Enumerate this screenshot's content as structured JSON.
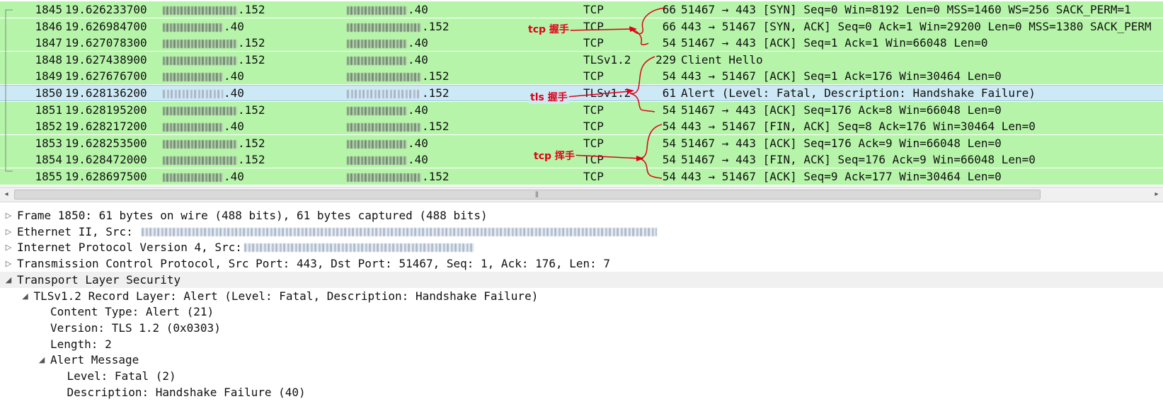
{
  "packets": [
    {
      "no": "1845",
      "time": "19.626233700",
      "src_suffix": ".152",
      "dst_suffix": ".40",
      "proto": "TCP",
      "len": "66",
      "info": "51467 → 443 [SYN] Seq=0 Win=8192 Len=0 MSS=1460 WS=256 SACK_PERM=1",
      "selected": false
    },
    {
      "no": "1846",
      "time": "19.626984700",
      "src_suffix": ".40",
      "dst_suffix": ".152",
      "proto": "TCP",
      "len": "66",
      "info": "443 → 51467 [SYN, ACK] Seq=0 Ack=1 Win=29200 Len=0 MSS=1380 SACK_PERM",
      "selected": false
    },
    {
      "no": "1847",
      "time": "19.627078300",
      "src_suffix": ".152",
      "dst_suffix": ".40",
      "proto": "TCP",
      "len": "54",
      "info": "51467 → 443 [ACK] Seq=1 Ack=1 Win=66048 Len=0",
      "selected": false
    },
    {
      "no": "1848",
      "time": "19.627438900",
      "src_suffix": ".152",
      "dst_suffix": ".40",
      "proto": "TLSv1.2",
      "len": "229",
      "info": "Client Hello",
      "selected": false
    },
    {
      "no": "1849",
      "time": "19.627676700",
      "src_suffix": ".40",
      "dst_suffix": ".152",
      "proto": "TCP",
      "len": "54",
      "info": "443 → 51467 [ACK] Seq=1 Ack=176 Win=30464 Len=0",
      "selected": false
    },
    {
      "no": "1850",
      "time": "19.628136200",
      "src_suffix": ".40",
      "dst_suffix": ".152",
      "proto": "TLSv1.2",
      "len": "61",
      "info": "Alert (Level: Fatal, Description: Handshake Failure)",
      "selected": true
    },
    {
      "no": "1851",
      "time": "19.628195200",
      "src_suffix": ".152",
      "dst_suffix": ".40",
      "proto": "TCP",
      "len": "54",
      "info": "51467 → 443 [ACK] Seq=176 Ack=8 Win=66048 Len=0",
      "selected": false
    },
    {
      "no": "1852",
      "time": "19.628217200",
      "src_suffix": ".40",
      "dst_suffix": ".152",
      "proto": "TCP",
      "len": "54",
      "info": "443 → 51467 [FIN, ACK] Seq=8 Ack=176 Win=30464 Len=0",
      "selected": false
    },
    {
      "no": "1853",
      "time": "19.628253500",
      "src_suffix": ".152",
      "dst_suffix": ".40",
      "proto": "TCP",
      "len": "54",
      "info": "51467 → 443 [ACK] Seq=176 Ack=9 Win=66048 Len=0",
      "selected": false
    },
    {
      "no": "1854",
      "time": "19.628472000",
      "src_suffix": ".152",
      "dst_suffix": ".40",
      "proto": "TCP",
      "len": "54",
      "info": "51467 → 443 [FIN, ACK] Seq=176 Ack=9 Win=66048 Len=0",
      "selected": false
    },
    {
      "no": "1855",
      "time": "19.628697500",
      "src_suffix": ".40",
      "dst_suffix": ".152",
      "proto": "TCP",
      "len": "54",
      "info": "443 → 51467 [ACK] Seq=9 Ack=177 Win=30464 Len=0",
      "selected": false
    }
  ],
  "annotations": {
    "tcp_handshake": "tcp 握手",
    "tls_handshake": "tls 握手",
    "tcp_teardown": "tcp 挥手",
    "color": "#e0001a"
  },
  "scrollbar": {
    "left_arrow": "◂",
    "right_arrow": "▸",
    "grip": "⦀"
  },
  "details": [
    {
      "text": "Frame 1850: 61 bytes on wire (488 bits), 61 bytes captured (488 bits)",
      "expander": "▷",
      "highlight": false
    },
    {
      "text": "Ethernet II, Src: ",
      "expander": "▷",
      "highlight": false,
      "blurred": true
    },
    {
      "text": "Internet Protocol Version 4, Src: ",
      "expander": "▷",
      "highlight": false,
      "blurred": true
    },
    {
      "text": "Transmission Control Protocol, Src Port: 443, Dst Port: 51467, Seq: 1, Ack: 176, Len: 7",
      "expander": "▷",
      "highlight": false
    },
    {
      "text": "Transport Layer Security",
      "expander": "◢",
      "highlight": true
    },
    {
      "text": "TLSv1.2 Record Layer: Alert (Level: Fatal, Description: Handshake Failure)",
      "expander": "◢",
      "highlight": false
    },
    {
      "text": "Content Type: Alert (21)",
      "expander": "",
      "highlight": false
    },
    {
      "text": "Version: TLS 1.2 (0x0303)",
      "expander": "",
      "highlight": false
    },
    {
      "text": "Length: 2",
      "expander": "",
      "highlight": false
    },
    {
      "text": "Alert Message",
      "expander": "◢",
      "highlight": false
    },
    {
      "text": "Level: Fatal (2)",
      "expander": "",
      "highlight": false
    },
    {
      "text": "Description: Handshake Failure (40)",
      "expander": "",
      "highlight": false
    }
  ],
  "colors": {
    "row_green": "#b6f5a9",
    "row_selected": "#cde9f6",
    "annotation_red": "#e0001a"
  }
}
